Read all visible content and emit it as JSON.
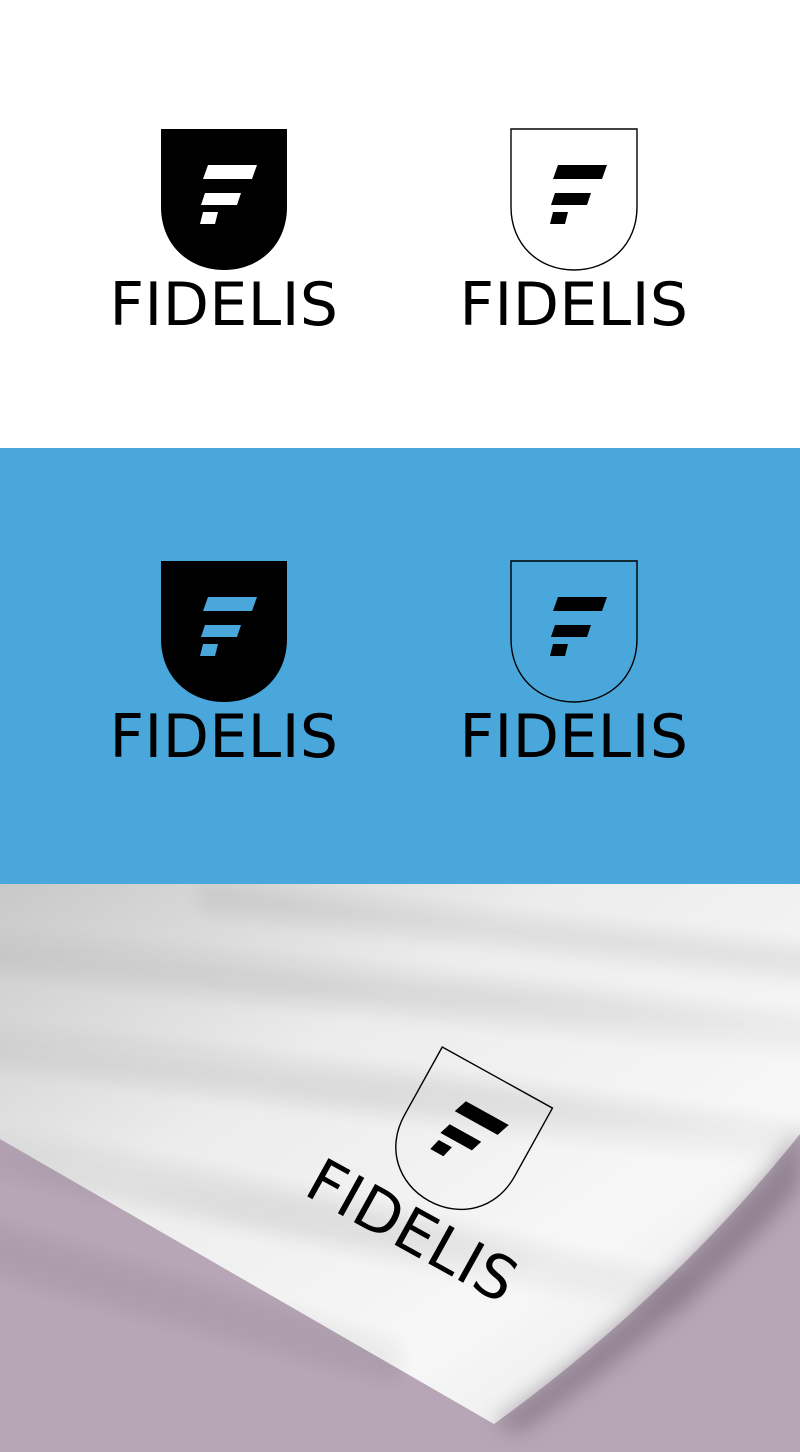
{
  "brand_name": "FIDELIS",
  "colors": {
    "white_panel_bg": "#ffffff",
    "blue_panel_bg": "#49a7db",
    "mockup_background": "#b6a6b6",
    "paper": "#f2f2f2",
    "ink": "#000000"
  },
  "panels": [
    {
      "name": "white-panel",
      "logos": [
        {
          "variant": "filled-shield",
          "text": "FIDELIS"
        },
        {
          "variant": "outline-shield",
          "text": "FIDELIS"
        }
      ]
    },
    {
      "name": "blue-panel",
      "logos": [
        {
          "variant": "filled-shield",
          "text": "FIDELIS"
        },
        {
          "variant": "outline-shield",
          "text": "FIDELIS"
        }
      ]
    },
    {
      "name": "paper-mockup",
      "logos": [
        {
          "variant": "outline-shield",
          "text": "FIDELIS"
        }
      ]
    }
  ]
}
